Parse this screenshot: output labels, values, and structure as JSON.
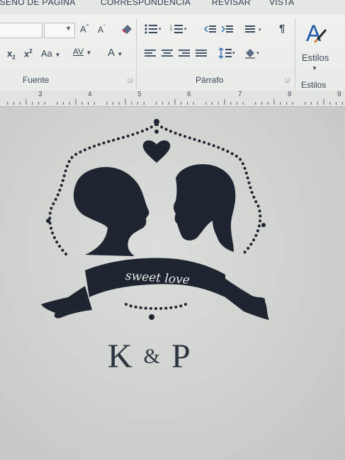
{
  "ribbon": {
    "tabs": [
      "ISEÑO DE PÁGINA",
      "CORRESPONDENCIA",
      "REVISAR",
      "VISTA"
    ],
    "groups": {
      "font": "Fuente",
      "paragraph": "Párrafo",
      "styles": "Estilos"
    },
    "styles_button": "Estilos",
    "font_controls": {
      "grow": "A",
      "shrink": "A",
      "case": "Aa",
      "spacing": "AV",
      "color": "A",
      "subscript": "x",
      "superscript": "x"
    },
    "pilcrow": "¶"
  },
  "ruler": {
    "numbers": [
      "3",
      "4",
      "5",
      "6",
      "7",
      "8",
      "9"
    ]
  },
  "document": {
    "banner_text": "sweet love",
    "initial_left": "K",
    "ampersand": "&",
    "initial_right": "P"
  },
  "colors": {
    "artwork": "#1e2530",
    "ribbon": "#eeefed",
    "page": "#d2d4d1"
  }
}
